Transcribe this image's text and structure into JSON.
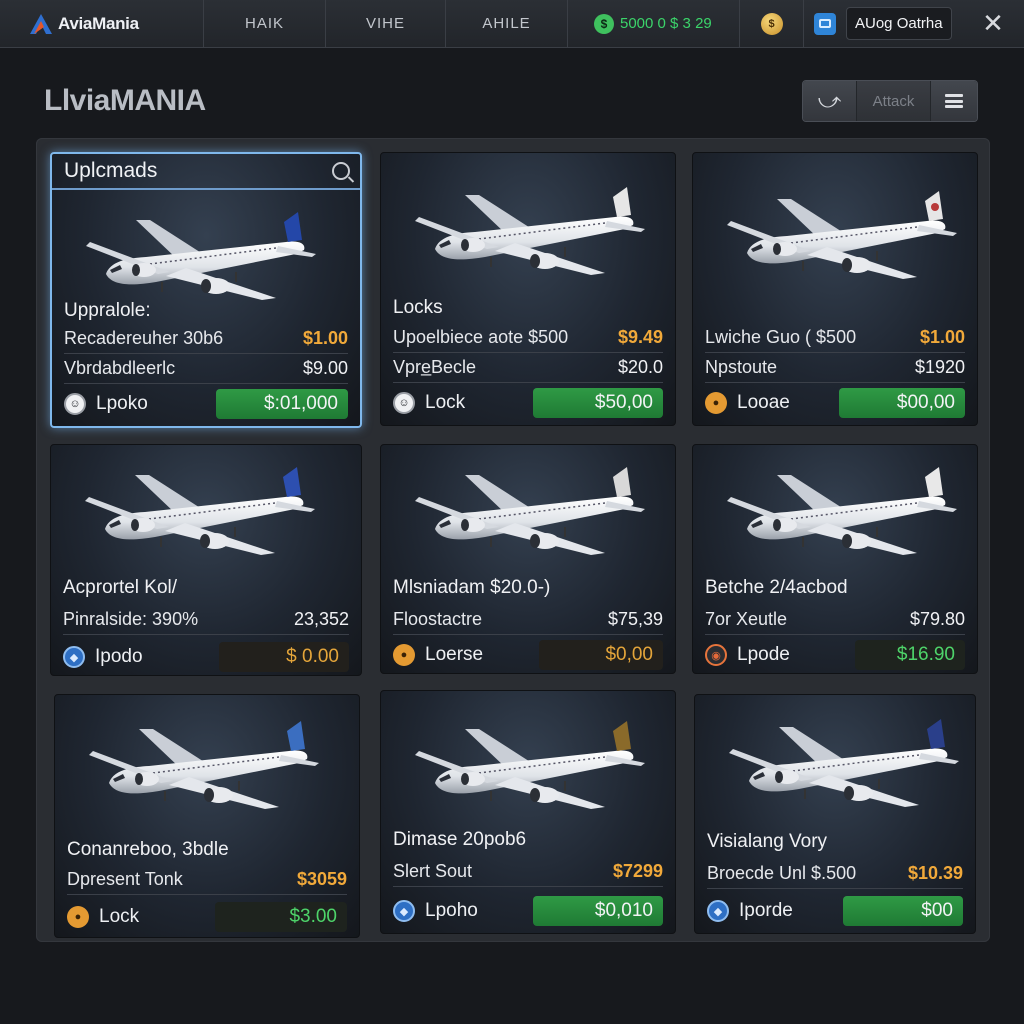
{
  "app": {
    "logo_text": "AviaMania"
  },
  "nav": {
    "tabs": [
      "HAIK",
      "VIHE",
      "AHILE"
    ]
  },
  "currency": {
    "amount": "5000 0 $ 3 29",
    "icon_glyph": "$"
  },
  "account": {
    "name": "AUog Oatrha"
  },
  "page": {
    "title": "LlviaMANIA"
  },
  "toolbar": {
    "back_glyph": "⤻",
    "attack_label": "Attack"
  },
  "colors": {
    "accent_green": "#2f9a45",
    "price_gold": "#f1a93a",
    "selection_blue": "#7fb8ec"
  },
  "cards": [
    {
      "title": "Uplcmads",
      "heading": "Uppralole:",
      "row1": {
        "label": "Recadereuher 30b6",
        "value": "$1.00"
      },
      "row2": {
        "label": "Vbrdabdleerlc",
        "value": "$9.00"
      },
      "action": {
        "label": "Lpoko",
        "price": "$:01,000"
      },
      "tail_color": "#2447a8"
    },
    {
      "heading": "Locks",
      "row1": {
        "label": "Upoelbiece aote $500",
        "value": "$9.49"
      },
      "row2": {
        "label": "Vpre̲Becle",
        "value": "$20.0"
      },
      "action": {
        "label": "Lock",
        "price": "$50,00"
      },
      "tail_color": "#c7a35a"
    },
    {
      "heading": "",
      "row1": {
        "label": "Lwiche Guo ( $500",
        "value": "$1.00"
      },
      "row2": {
        "label": "Npstoute",
        "value": "$1920"
      },
      "action": {
        "label": "Looae",
        "price": "$00,00"
      },
      "tail_color": "#b83a3a"
    },
    {
      "heading": "Acprortel Kol/",
      "row1": {
        "label": "Pinralside: 390%",
        "value": "23,352"
      },
      "action": {
        "label": "Ipodo",
        "price": "$ 0.00"
      },
      "tail_color": "#2d4fb0"
    },
    {
      "heading": "Mlsniadam $20.0-)",
      "row1": {
        "label": "Floostactre",
        "value": "$75,39"
      },
      "action": {
        "label": "Loerse",
        "price": "$0,00"
      },
      "tail_color": "#d8d8d8"
    },
    {
      "heading": "Betche 2/4acbod",
      "row1": {
        "label": "7or Xeutle",
        "value": "$79.80"
      },
      "action": {
        "label": "Lpode",
        "price": "$16.90"
      },
      "tail_color": "#e8e8e8"
    },
    {
      "heading": "Conanreboo, 3bdle",
      "row1": {
        "label": "Dpresent Tonk",
        "value": "$3059"
      },
      "action": {
        "label": "Lock",
        "price": "$3.00"
      },
      "tail_color": "#3b6ec0"
    },
    {
      "heading": "Dimase 20pob6",
      "row1": {
        "label": "Slert Sout",
        "value": "$7299"
      },
      "action": {
        "label": "Lpoho",
        "price": "$0,010"
      },
      "tail_color": "#8a6a2a"
    },
    {
      "heading": "Visialang Vory",
      "row1": {
        "label": "Broecde Unl $.500",
        "value": "$10.39"
      },
      "action": {
        "label": "Iporde",
        "price": "$00"
      },
      "tail_color": "#2a3f8a"
    }
  ]
}
